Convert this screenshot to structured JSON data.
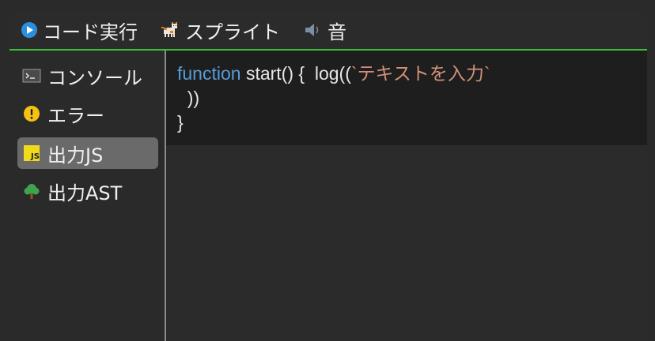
{
  "tabs": [
    {
      "label": "コード実行",
      "icon": "play-icon"
    },
    {
      "label": "スプライト",
      "icon": "cat-icon"
    },
    {
      "label": "音",
      "icon": "speaker-icon"
    }
  ],
  "sidebar": {
    "items": [
      {
        "label": "コンソール",
        "icon": "terminal-icon"
      },
      {
        "label": "エラー",
        "icon": "warning-icon"
      },
      {
        "label": "出力JS",
        "icon": "js-icon",
        "active": true
      },
      {
        "label": "出力AST",
        "icon": "tree-icon"
      }
    ]
  },
  "editor": {
    "line1_keyword": "function",
    "line1_code": " start() {  log((",
    "line1_string": "`テキストを入力`",
    "line2": "  ))",
    "line3": "}"
  },
  "colors": {
    "accent_green": "#3cc23c",
    "keyword_blue": "#569cd6",
    "string_orange": "#ce9178",
    "active_item": "#6a6a6a"
  }
}
